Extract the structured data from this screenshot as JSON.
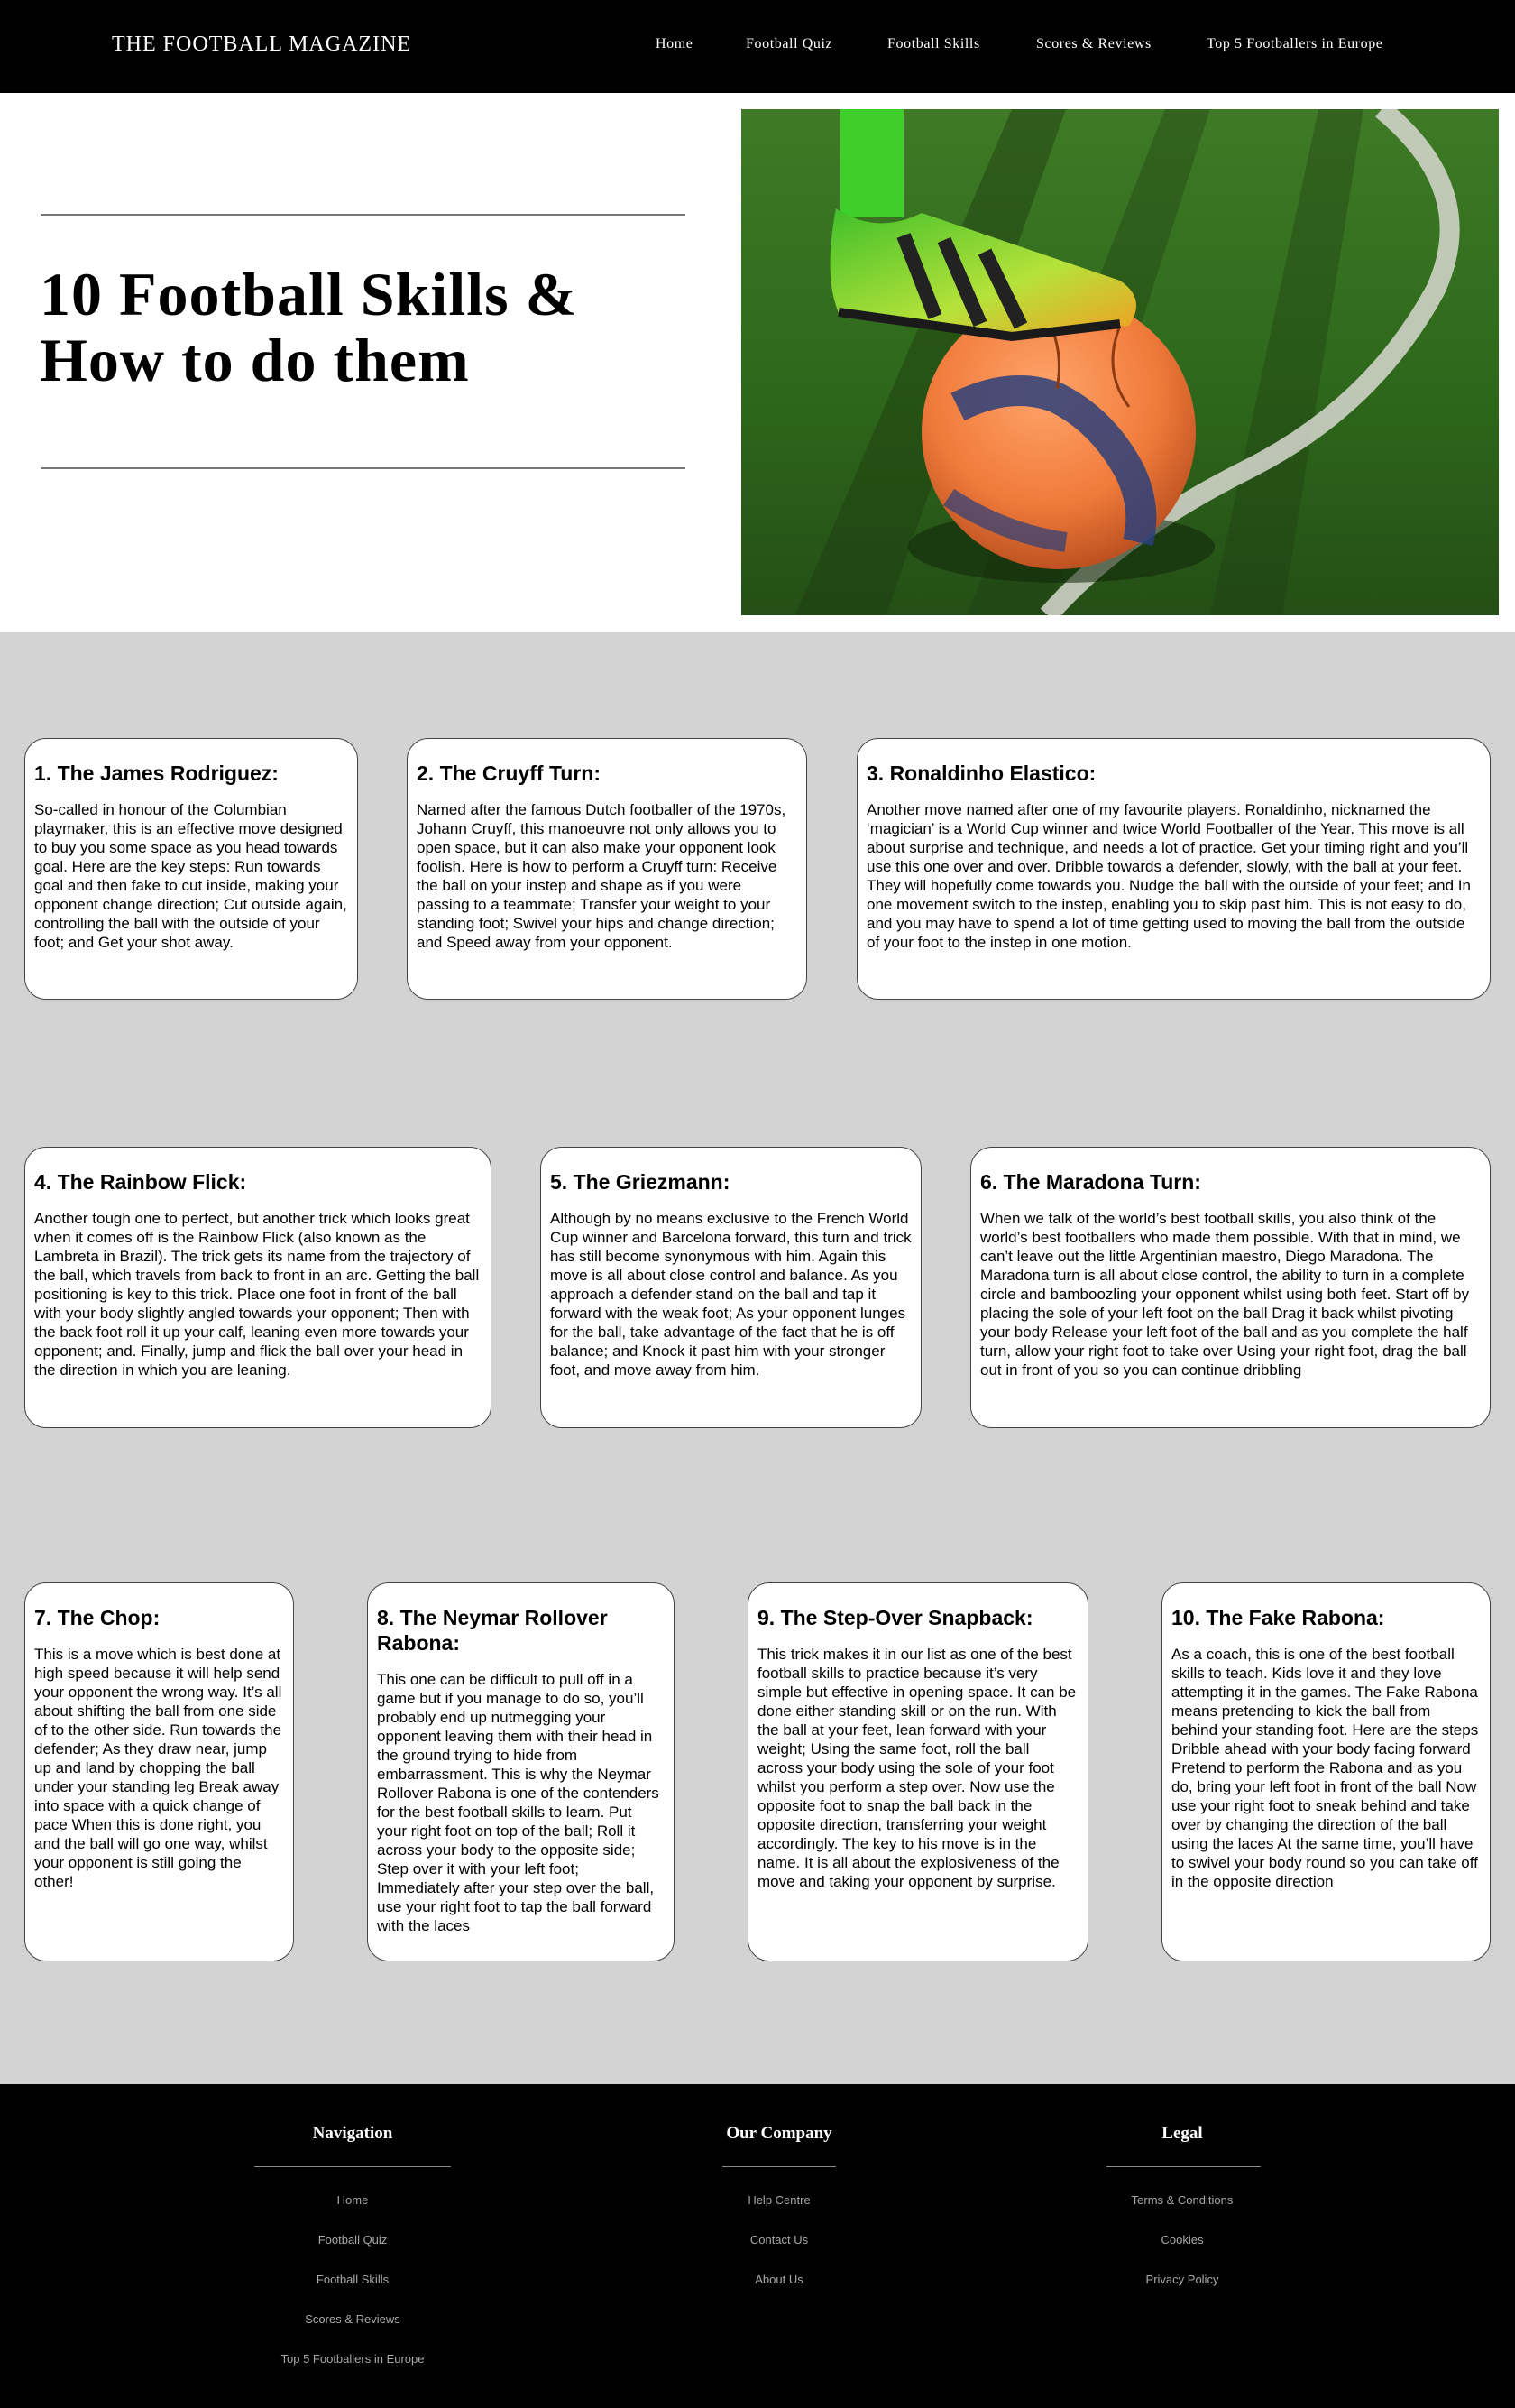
{
  "header": {
    "brand": "THE FOOTBALL MAGAZINE",
    "nav": [
      "Home",
      "Football Quiz",
      "Football Skills",
      "Scores & Reviews",
      "Top 5 Footballers in Europe"
    ]
  },
  "hero": {
    "title_line1": "10 Football Skills &",
    "title_line2": "How to do them"
  },
  "skills": [
    {
      "title": "1. The James Rodriguez:",
      "text": "So-called in honour of the Columbian playmaker, this is an effective move designed to buy you some space as you head towards goal. Here are the key steps: Run towards goal and then fake to cut inside, making your opponent change direction; Cut outside again, controlling the ball with the outside of your foot; and Get your shot away."
    },
    {
      "title": "2. The Cruyff Turn:",
      "text": "Named after the famous Dutch footballer of the 1970s, Johann Cruyff, this manoeuvre not only allows you to open space, but it can also make your opponent look foolish. Here is how to perform a Cruyff turn: Receive the ball on your instep and shape as if you were passing to a teammate; Transfer your weight to your standing foot; Swivel your hips and change direction; and Speed away from your opponent."
    },
    {
      "title": "3. Ronaldinho Elastico:",
      "text": "Another move named after one of my favourite players. Ronaldinho, nicknamed the ‘magician’ is a World Cup winner and twice World Footballer of the Year. This move is all about surprise and technique, and needs a lot of practice. Get your timing right and you’ll use this one over and over. Dribble towards a defender, slowly, with the ball at your feet. They will hopefully come towards you. Nudge the ball with the outside of your feet; and In one movement switch to the instep, enabling you to skip past him. This is not easy to do, and you may have to spend a lot of time getting used to moving the ball from the outside of your foot to the instep in one motion."
    },
    {
      "title": "4. The Rainbow Flick:",
      "text": "Another tough one to perfect, but another trick which looks great when it comes off is the Rainbow Flick (also known as the Lambreta in Brazil). The trick gets its name from the trajectory of the ball, which travels from back to front in an arc. Getting the ball positioning is key to this trick. Place one foot in front of the ball with your body slightly angled towards your opponent; Then with the back foot roll it up your calf, leaning even more towards your opponent; and. Finally, jump and flick the ball over your head in the direction in which you are leaning."
    },
    {
      "title": "5. The Griezmann:",
      "text": "Although by no means exclusive to the French World Cup winner and Barcelona forward, this turn and trick has still become synonymous with him. Again this move is all about close control and balance. As you approach a defender stand on the ball and tap it forward with the weak foot; As your opponent lunges for the ball, take advantage of the fact that he is off balance; and Knock it past him with your stronger foot, and move away from him."
    },
    {
      "title": "6. The Maradona Turn:",
      "text": "When we talk of the world’s best football skills, you also think of the world’s best footballers who made them possible. With that in mind, we can’t leave out the little Argentinian maestro, Diego Maradona. The Maradona turn is all about close control, the ability to turn in a complete circle and bamboozling your opponent whilst using both feet. Start off by placing the sole of your left foot on the ball Drag it back whilst pivoting your body Release your left foot of the ball and as you complete the half turn, allow your right foot to take over Using your right foot, drag the ball out in front of you so you can continue dribbling"
    },
    {
      "title": "7. The Chop:",
      "text": "This is a move which is best done at high speed because it will help send your opponent the wrong way. It’s all about shifting the ball from one side of to the other side. Run towards the defender; As they draw near, jump up and land by chopping the ball under your standing leg Break away into space with a quick change of pace When this is done right, you and the ball will go one way, whilst your opponent is still going the other!"
    },
    {
      "title": "8. The Neymar Rollover Rabona:",
      "text": "This one can be difficult to pull off in a game but if you manage to do so, you’ll probably end up nutmegging your opponent leaving them with their head in the ground trying to hide from embarrassment. This is why the Neymar Rollover Rabona is one of the contenders for the best football skills to learn. Put your right foot on top of the ball; Roll it across your body to the opposite side; Step over it with your left foot; Immediately after your step over the ball, use your right foot to tap the ball forward with the laces"
    },
    {
      "title": "9. The Step-Over Snapback:",
      "text": "This trick makes it in our list as one of the best football skills to practice because it’s very simple but effective in opening space. It can be done either standing skill or on the run. With the ball at your feet, lean forward with your weight; Using the same foot, roll the ball across your body using the sole of your foot whilst you perform a step over. Now use the opposite foot to snap the ball back in the opposite direction, transferring your weight accordingly. The key to his move is in the name. It is all about the explosiveness of the move and taking your opponent by surprise."
    },
    {
      "title": "10. The Fake Rabona:",
      "text": "As a coach, this is one of the best football skills to teach. Kids love it and they love attempting it in the games. The Fake Rabona means pretending to kick the ball from behind your standing foot. Here are the steps Dribble ahead with your body facing forward Pretend to perform the Rabona and as you do, bring your left foot in front of the ball Now use your right foot to sneak behind and take over by changing the direction of the ball using the laces At the same time, you’ll have to swivel your body round so you can take off in the opposite direction"
    }
  ],
  "footer": {
    "navigation": {
      "heading": "Navigation",
      "links": [
        "Home",
        "Football Quiz",
        "Football Skills",
        "Scores & Reviews",
        "Top 5 Footballers in Europe"
      ]
    },
    "company": {
      "heading": "Our Company",
      "links": [
        "Help Centre",
        "Contact Us",
        "About Us"
      ]
    },
    "legal": {
      "heading": "Legal",
      "links": [
        "Terms & Conditions",
        "Cookies",
        "Privacy Policy"
      ]
    }
  },
  "colors": {
    "header_bg": "#000000",
    "page_bg": "#d3d3d3",
    "card_bg": "#ffffff",
    "footer_link": "#a8a8a8"
  }
}
